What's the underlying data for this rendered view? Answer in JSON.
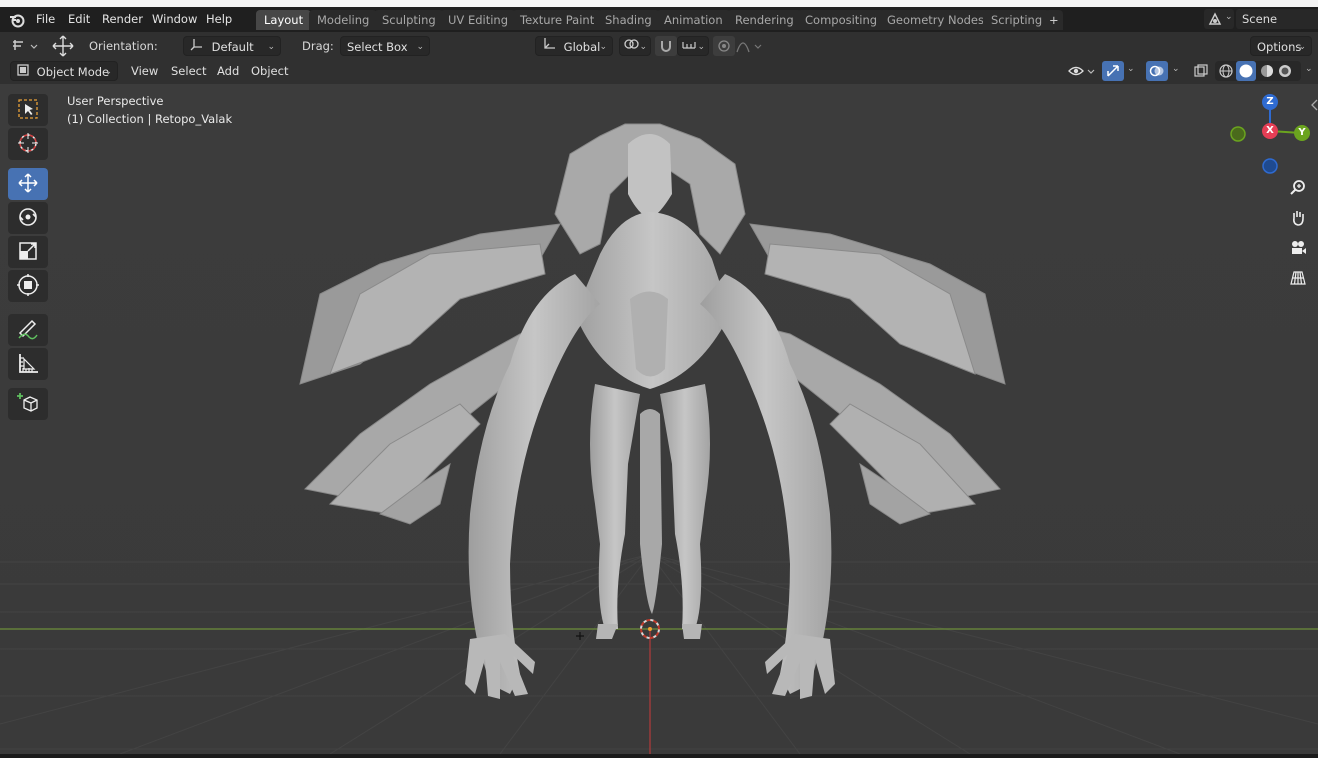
{
  "menu": {
    "items": [
      "File",
      "Edit",
      "Render",
      "Window",
      "Help"
    ]
  },
  "workspaces": {
    "tabs": [
      "Layout",
      "Modeling",
      "Sculpting",
      "UV Editing",
      "Texture Paint",
      "Shading",
      "Animation",
      "Rendering",
      "Compositing",
      "Geometry Nodes",
      "Scripting"
    ],
    "active": "Layout",
    "add": "+"
  },
  "scene": {
    "name": "Scene"
  },
  "header": {
    "orientation_label": "Orientation:",
    "orientation_value": "Default",
    "drag_label": "Drag:",
    "drag_value": "Select Box",
    "transform_space": "Global",
    "options": "Options"
  },
  "header2": {
    "mode": "Object Mode",
    "view": "View",
    "select": "Select",
    "add": "Add",
    "object": "Object"
  },
  "viewport": {
    "perspective": "User Perspective",
    "collection": "(1) Collection | Retopo_Valak"
  },
  "gizmo": {
    "z": "Z",
    "x": "X",
    "y": "Y"
  },
  "colors": {
    "active_tool": "#4772b3",
    "x_axis": "#e53e55",
    "y_axis": "#6ba41f",
    "z_axis": "#2f6bd1",
    "floor_line_green": "#6d8f3a",
    "floor_line_red": "#a23a3a",
    "model": "#bdbdbd"
  },
  "tools": [
    "select-box",
    "cursor",
    "move",
    "rotate",
    "scale",
    "transform",
    "annotate",
    "measure",
    "add-cube"
  ]
}
